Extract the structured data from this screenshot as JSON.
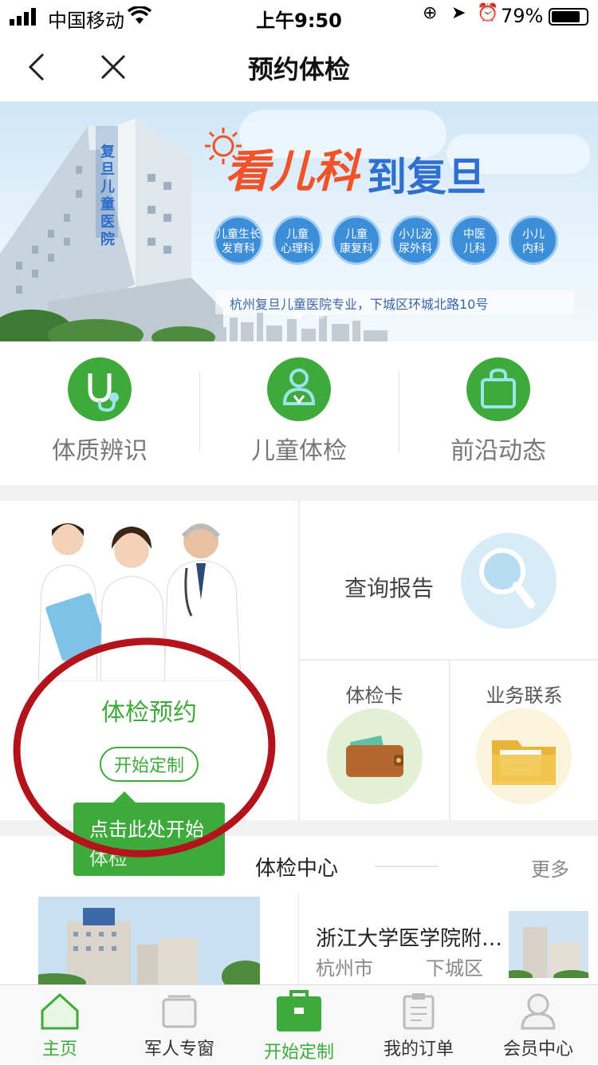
{
  "status": {
    "carrier": "中国移动",
    "time": "上午9:50",
    "battery": "79%"
  },
  "nav": {
    "title": "预约体检",
    "back_icon": "chevron-left-icon",
    "close_icon": "close-icon"
  },
  "banner": {
    "headline_1": "看儿科",
    "headline_2": "到复旦",
    "building_sign": "复旦儿童医院",
    "tags": [
      {
        "line1": "儿童生长",
        "line2": "发育科"
      },
      {
        "line1": "儿童",
        "line2": "心理科"
      },
      {
        "line1": "儿童",
        "line2": "康复科"
      },
      {
        "line1": "小儿泌",
        "line2": "尿外科"
      },
      {
        "line1": "中医",
        "line2": "儿科"
      },
      {
        "line1": "小儿",
        "line2": "内科"
      }
    ],
    "address": "杭州复旦儿童医院专业，下城区环城北路10号"
  },
  "quick_menu": [
    {
      "label": "体质辨识",
      "icon": "stethoscope-icon"
    },
    {
      "label": "儿童体检",
      "icon": "child-icon"
    },
    {
      "label": "前沿动态",
      "icon": "bag-icon"
    }
  ],
  "grid": {
    "appointment_title": "体检预约",
    "appointment_button": "开始定制",
    "query_report": "查询报告",
    "card": "体检卡",
    "contact": "业务联系"
  },
  "tooltip": {
    "text_line1": "点击此处开始",
    "text_line2": "体检"
  },
  "center": {
    "title": "体检中心",
    "more": "更多"
  },
  "hospital": {
    "name": "浙江大学医学院附…",
    "city": "杭州市",
    "district": "下城区"
  },
  "tabs": [
    {
      "label": "主页",
      "icon": "home-icon",
      "active": true
    },
    {
      "label": "军人专窗",
      "icon": "window-icon",
      "active": false
    },
    {
      "label": "开始定制",
      "icon": "briefcase-icon",
      "active": false
    },
    {
      "label": "我的订单",
      "icon": "clipboard-icon",
      "active": false
    },
    {
      "label": "会员中心",
      "icon": "user-icon",
      "active": false
    }
  ],
  "colors": {
    "accent": "#3faa3c",
    "banner_blue": "#2f6fd0",
    "banner_orange": "#f0522a",
    "annotation_red": "#b3141b"
  }
}
